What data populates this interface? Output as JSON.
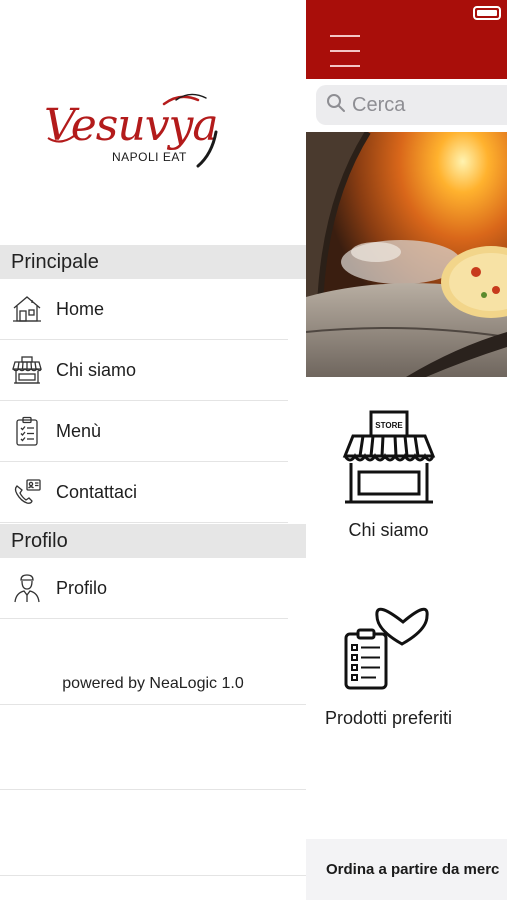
{
  "drawer": {
    "logo": {
      "wordmark": "Vesuvya",
      "tagline": "NAPOLI EAT"
    },
    "sections": [
      {
        "title": "Principale",
        "items": [
          {
            "label": "Home",
            "icon": "house-icon"
          },
          {
            "label": "Chi siamo",
            "icon": "store-icon"
          },
          {
            "label": "Menù",
            "icon": "clipboard-list-icon"
          },
          {
            "label": "Contattaci",
            "icon": "phone-contact-icon"
          }
        ]
      },
      {
        "title": "Profilo",
        "items": [
          {
            "label": "Profilo",
            "icon": "chef-avatar-icon"
          }
        ]
      }
    ],
    "footer": "powered by NeaLogic 1.0"
  },
  "main": {
    "search": {
      "placeholder": "Cerca"
    },
    "tiles": [
      {
        "label": "Chi siamo",
        "icon": "store-icon",
        "sign": "STORE"
      },
      {
        "label": "Prodotti preferiti",
        "icon": "heart-clipboard-icon"
      }
    ],
    "bottom_banner": "Ordina a partire da merc"
  },
  "colors": {
    "brand_red": "#a90e0a",
    "section_header_bg": "#e6e6e6",
    "search_bg": "#ececee"
  }
}
